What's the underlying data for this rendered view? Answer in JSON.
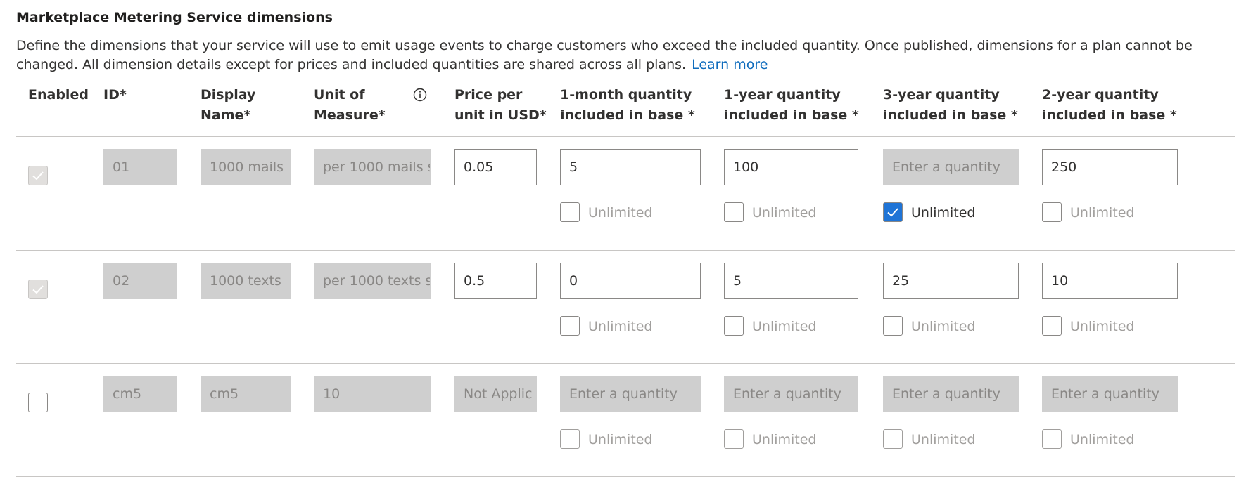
{
  "section": {
    "title": "Marketplace Metering Service dimensions",
    "description": "Define the dimensions that your service will use to emit usage events to charge customers who exceed the included quantity. Once published, dimensions for a plan cannot be changed. All dimension details except for prices and included quantities are shared across all plans.",
    "learn_more": "Learn more"
  },
  "columns": {
    "enabled": "Enabled",
    "id": "ID*",
    "display_name_1": "Display",
    "display_name_2": "Name*",
    "unit_1": "Unit of",
    "unit_2": "Measure*",
    "price_1": "Price per",
    "price_2": "unit in USD*",
    "m1_1": "1-month quantity",
    "m1_2": "included in base *",
    "y1_1": "1-year quantity",
    "y1_2": "included in base *",
    "y3_1": "3-year quantity",
    "y3_2": "included in base *",
    "y2_1": "2-year quantity",
    "y2_2": "included in base *"
  },
  "unlimited_label": "Unlimited",
  "quantity_placeholder": "Enter a quantity",
  "rows": [
    {
      "enabled": true,
      "enabled_disabled": true,
      "id": "01",
      "display_name": "1000 mails",
      "unit": "per 1000 mails s",
      "price": "0.05",
      "m1": "5",
      "y1": "100",
      "y3": "",
      "y2": "250",
      "unlimited": {
        "m1": false,
        "y1": false,
        "y3": true,
        "y2": false
      }
    },
    {
      "enabled": true,
      "enabled_disabled": true,
      "id": "02",
      "display_name": "1000 texts",
      "unit": "per 1000 texts s",
      "price": "0.5",
      "m1": "0",
      "y1": "5",
      "y3": "25",
      "y2": "10",
      "unlimited": {
        "m1": false,
        "y1": false,
        "y3": false,
        "y2": false
      }
    },
    {
      "enabled": false,
      "enabled_disabled": false,
      "id": "cm5",
      "display_name": "cm5",
      "unit": "10",
      "price": "Not Applic",
      "m1": "",
      "y1": "",
      "y3": "",
      "y2": "",
      "unlimited": {
        "m1": false,
        "y1": false,
        "y3": false,
        "y2": false
      }
    }
  ],
  "colors": {
    "accent": "#1f74d6",
    "link": "#0f6cbd",
    "disabled_fill": "#cfcfcf",
    "border": "#8a8886"
  },
  "icons": {
    "info": "info-icon",
    "check": "checkmark-icon"
  }
}
